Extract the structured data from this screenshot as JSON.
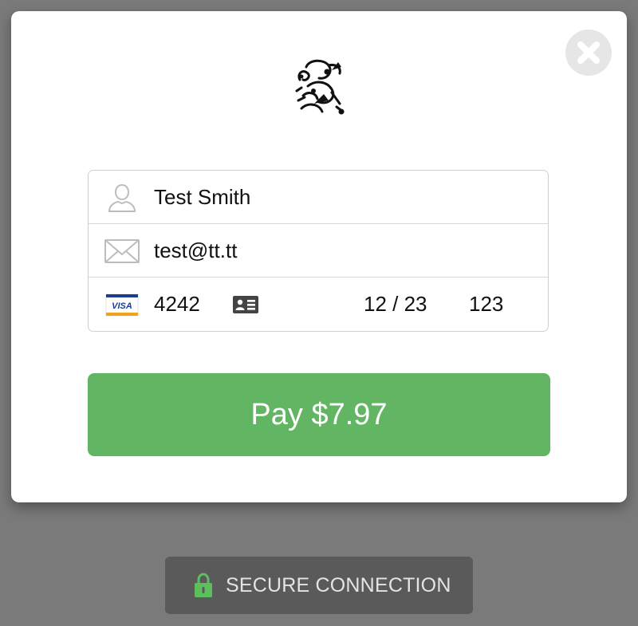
{
  "checkout": {
    "close_icon": "close-icon",
    "logo_icon": "frog-logo-icon",
    "form": {
      "name": {
        "icon": "user-icon",
        "value": "Test Smith"
      },
      "email": {
        "icon": "envelope-icon",
        "value": "test@tt.tt"
      },
      "card": {
        "brand_icon": "visa-icon",
        "number_value": "4242",
        "id_icon": "id-card-icon",
        "expiry_value": "12 / 23",
        "cvc_value": "123"
      }
    },
    "pay_button": {
      "label": "Pay $7.97",
      "color": "#62b562"
    }
  },
  "security_badge": {
    "icon": "lock-icon",
    "label": "SECURE CONNECTION",
    "icon_color": "#5cbf5c"
  }
}
